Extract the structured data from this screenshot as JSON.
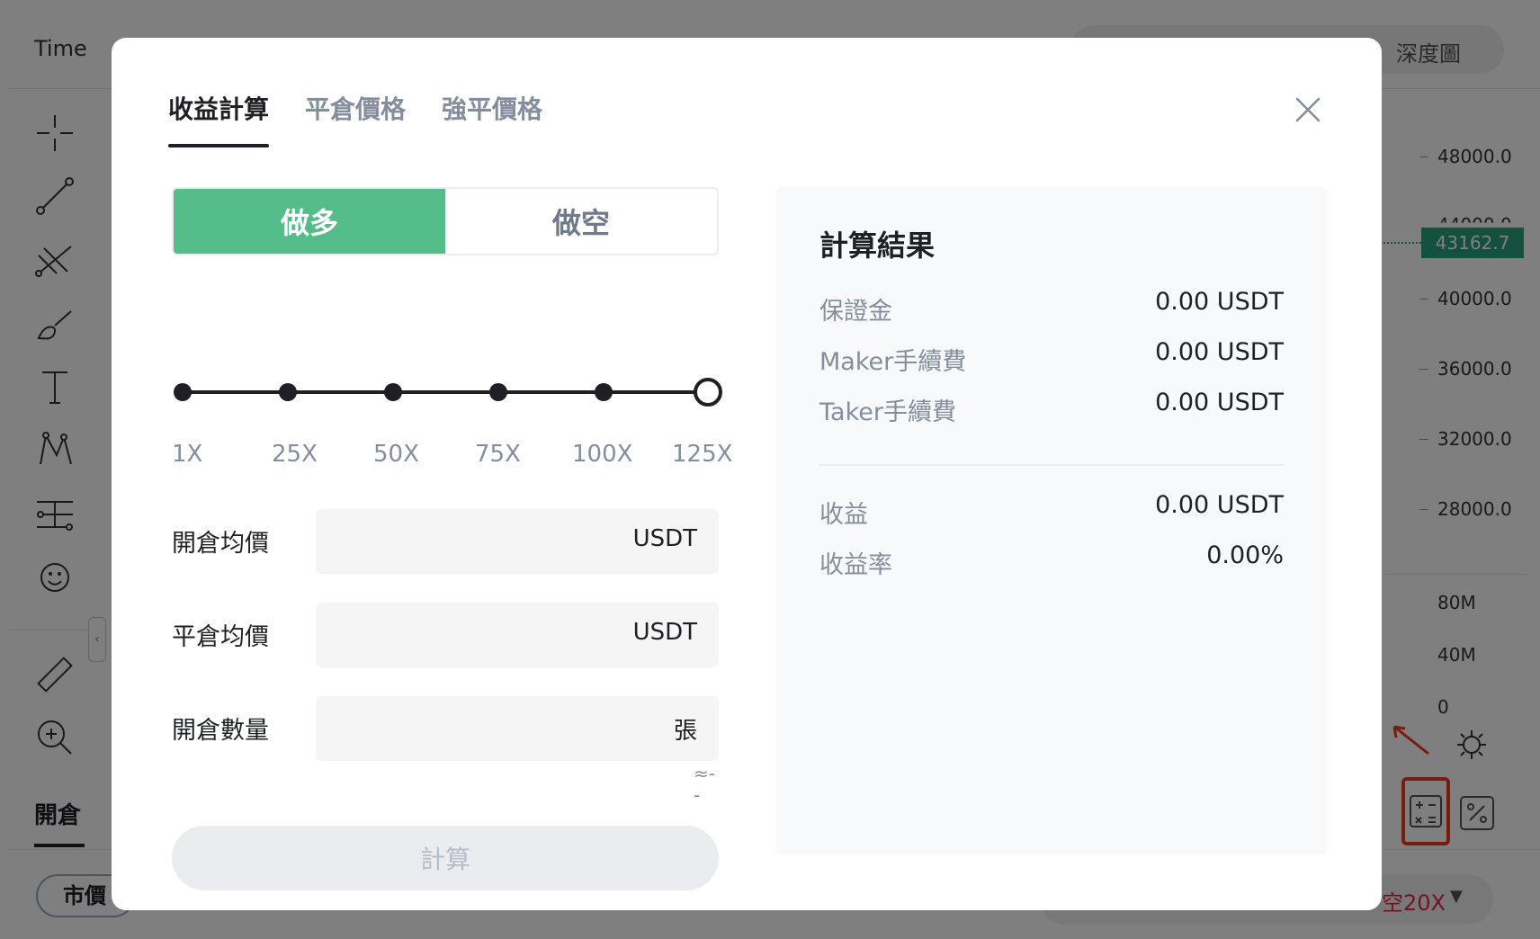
{
  "background": {
    "time_label": "Time",
    "depth_label": "深度圖",
    "price_axis": [
      "48000.0",
      "44000.0",
      "40000.0",
      "36000.0",
      "32000.0",
      "28000.0"
    ],
    "volume_axis": [
      "80M",
      "40M",
      "0"
    ],
    "current_price": "43162.7",
    "position_tab": "開倉",
    "market_label": "市價",
    "leverage_label": "空20X",
    "colors": {
      "up": "#26a17b",
      "short": "#e0294a",
      "highlight": "#ee3a21"
    }
  },
  "modal": {
    "tabs": [
      {
        "label": "收益計算",
        "active": true
      },
      {
        "label": "平倉價格",
        "active": false
      },
      {
        "label": "強平價格",
        "active": false
      }
    ],
    "side": {
      "long_label": "做多",
      "short_label": "做空",
      "selected": "long"
    },
    "leverage": {
      "labels": [
        "1X",
        "25X",
        "50X",
        "75X",
        "100X",
        "125X"
      ],
      "selected": "125X"
    },
    "fields": {
      "entry_price": {
        "label": "開倉均價",
        "unit": "USDT",
        "value": ""
      },
      "exit_price": {
        "label": "平倉均價",
        "unit": "USDT",
        "value": ""
      },
      "quantity": {
        "label": "開倉數量",
        "unit": "張",
        "value": "",
        "approx": "≈--"
      }
    },
    "calculate_label": "計算",
    "result": {
      "title": "計算結果",
      "rows": [
        {
          "label": "保證金",
          "value": "0.00 USDT"
        },
        {
          "label": "Maker手續費",
          "value": "0.00 USDT"
        },
        {
          "label": "Taker手續費",
          "value": "0.00 USDT"
        }
      ],
      "summary": [
        {
          "label": "收益",
          "value": "0.00 USDT"
        },
        {
          "label": "收益率",
          "value": "0.00%"
        }
      ]
    },
    "colors": {
      "long": "#55bd8a",
      "text": "#1e2026",
      "muted": "#848e9c"
    }
  }
}
